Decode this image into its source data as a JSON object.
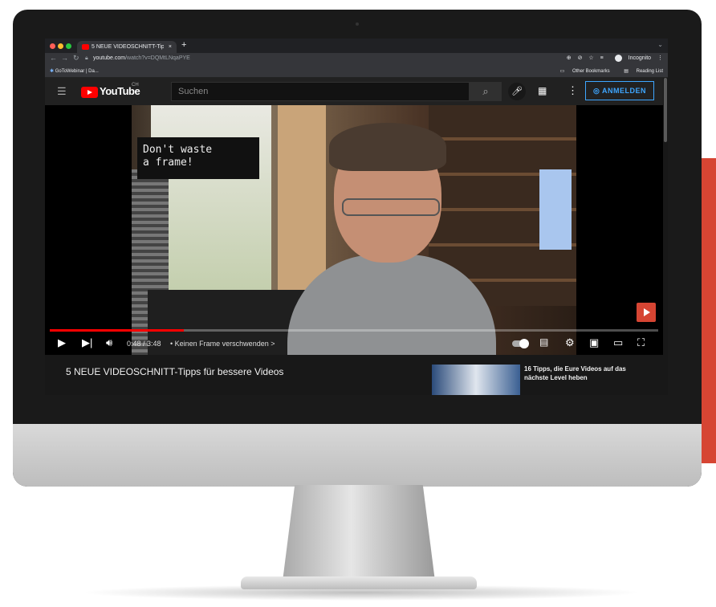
{
  "browser": {
    "tab_title": "5 NEUE VIDEOSCHNITT-Tipps",
    "tab_close": "×",
    "new_tab": "+",
    "url_host": "youtube.com",
    "url_path": "/watch?v=DQMtLNqaPYE",
    "incognito_label": "Incognito",
    "bookmark_left": "GoToWebinar | Da...",
    "bookmark_other": "Other Bookmarks",
    "bookmark_reading": "Reading List"
  },
  "youtube": {
    "logo_text": "YouTube",
    "region": "CH",
    "search_placeholder": "Suchen",
    "signin_label": "ANMELDEN"
  },
  "player": {
    "caption_text": "Don't waste\na frame!",
    "time": "0:48 / 3:48",
    "chapter": "• Keinen Frame verschwenden",
    "chapter_chevron": ">",
    "progress_fraction": 0.22
  },
  "video": {
    "title": "5 NEUE VIDEOSCHNITT-Tipps für bessere Videos"
  },
  "related": [
    {
      "title": "16 Tipps, die Eure Videos auf das nächste Level heben"
    }
  ],
  "colors": {
    "accent_red": "#ff0000",
    "signin_blue": "#3ea6ff",
    "side_panel": "#d64533"
  }
}
